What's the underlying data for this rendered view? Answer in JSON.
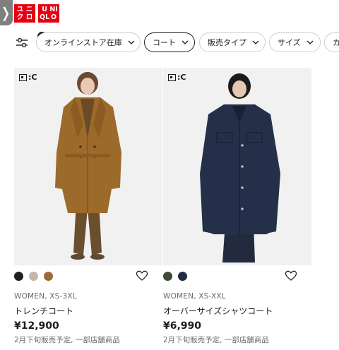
{
  "header": {
    "back_glyph": "❭",
    "logo_top": [
      "ユ",
      "ニ",
      "ク",
      "ロ"
    ],
    "logo_bottom": [
      "U",
      "NI",
      "QL",
      "O"
    ],
    "logo_color": "#e60012"
  },
  "filters": {
    "badge_count": "1",
    "chips": [
      {
        "label": "オンラインストア在庫",
        "active": false
      },
      {
        "label": "コート",
        "active": true
      },
      {
        "label": "販売タイプ",
        "active": false
      },
      {
        "label": "サイズ",
        "active": false
      },
      {
        "label": "カ",
        "active": false
      }
    ]
  },
  "products": [
    {
      "badge": ":C",
      "swatches": [
        "#1f1f1f",
        "#c8b7a4",
        "#9a6a3a"
      ],
      "meta": "WOMEN, XS-3XL",
      "name": "トレンチコート",
      "price": "¥12,900",
      "note": "2月下旬販売予定, 一部店舗商品"
    },
    {
      "badge": ":C",
      "swatches": [
        "#3f4a3b",
        "#222c46"
      ],
      "meta": "WOMEN, XS-XXL",
      "name": "オーバーサイズシャツコート",
      "price": "¥6,990",
      "note": "2月下旬販売予定, 一部店舗商品"
    }
  ]
}
